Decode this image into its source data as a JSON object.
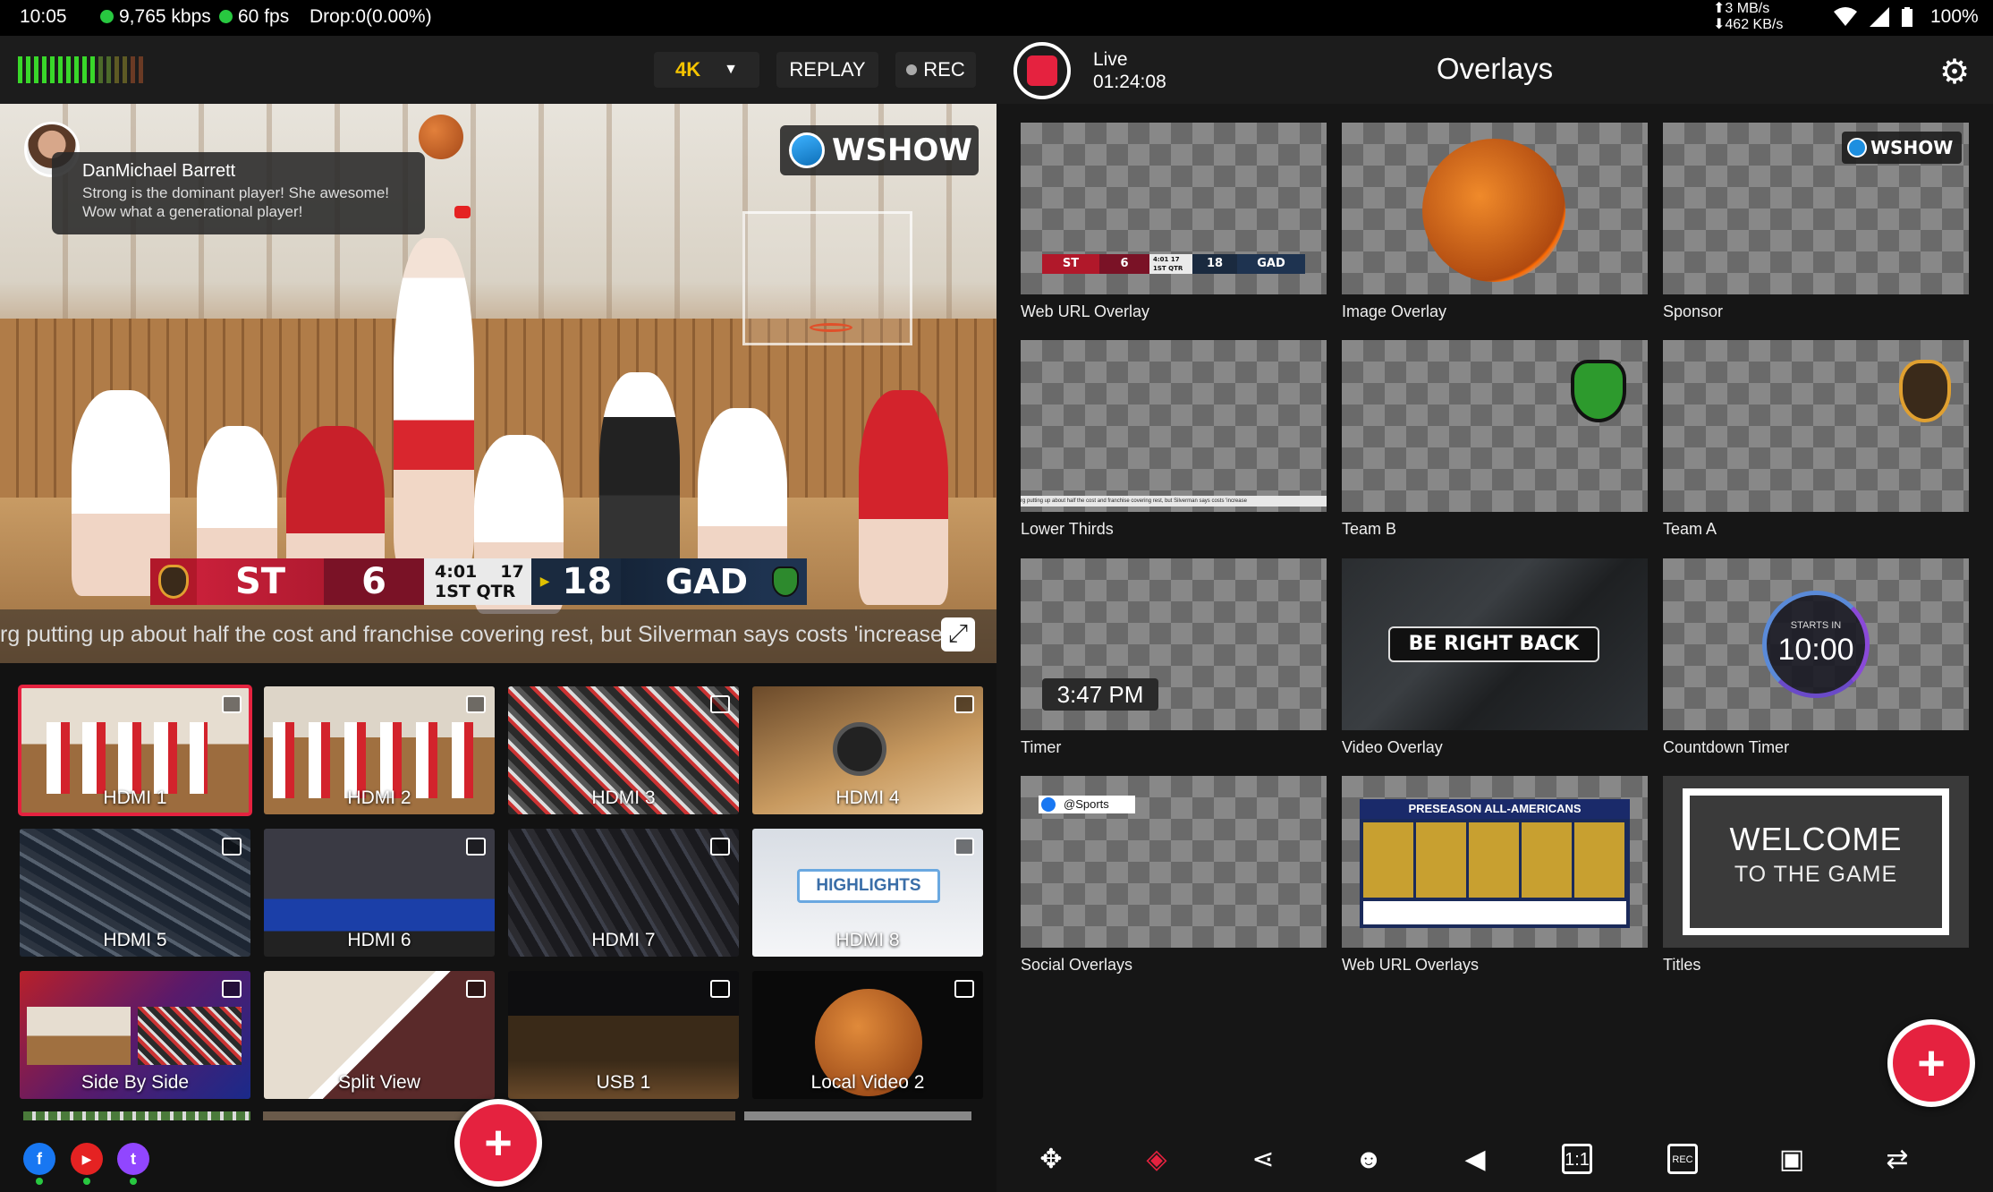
{
  "status": {
    "time": "10:05",
    "bitrate": "9,765 kbps",
    "fps": "60 fps",
    "drop": "Drop:0(0.00%)",
    "upload": "3 MB/s",
    "download": "462 KB/s",
    "battery": "100%"
  },
  "left": {
    "resolution": "4K",
    "replay": "REPLAY",
    "rec": "REC",
    "comment": {
      "name": "DanMichael Barrett",
      "line1": "Strong is the dominant player! She awesome!",
      "line2": "Wow what a generational player!"
    },
    "brand": "WSHOW",
    "score": {
      "home": "ST",
      "home_score": "6",
      "clock": "4:01",
      "shot": "17",
      "period": "1ST QTR",
      "away_score": "18",
      "away": "GAD"
    },
    "ticker": "rg putting up about half the cost and franchise covering rest, but Silverman says costs 'increase",
    "sources": [
      "HDMI 1",
      "HDMI 2",
      "HDMI 3",
      "HDMI 4",
      "HDMI 5",
      "HDMI 6",
      "HDMI 7",
      "HDMI 8",
      "Side By Side",
      "Split View",
      "USB 1",
      "Local Video 2"
    ],
    "highlights_text": "HIGHLIGHTS",
    "social": [
      "f",
      "▶",
      "t"
    ],
    "fab": "+"
  },
  "right": {
    "live": "Live",
    "duration": "01:24:08",
    "title": "Overlays",
    "overlays": [
      "Web URL Overlay",
      "Image Overlay",
      "Sponsor",
      "Lower Thirds",
      "Team B",
      "Team A",
      "Timer",
      "Video Overlay",
      "Countdown Timer",
      "Social Overlays",
      "Web URL Overlays",
      "Titles"
    ],
    "timer_text": "3:47 PM",
    "brb_text": "BE RIGHT BACK",
    "countdown": {
      "label": "STARTS IN",
      "value": "10:00"
    },
    "social_handle": "@Sports",
    "preseason": "PRESEASON ALL-AMERICANS",
    "welcome": {
      "line1": "WELCOME",
      "line2": "TO THE GAME"
    },
    "lower_third_text": "rg putting up about half the cost and franchise covering rest, but Silverman says costs 'increase",
    "mini_score": {
      "home": "ST",
      "home_score": "6",
      "clock": "4:01 17",
      "period": "1ST QTR",
      "away_score": "18",
      "away": "GAD"
    },
    "fab": "+"
  },
  "colors": {
    "accent": "#e5223f",
    "live_green": "#28c840"
  }
}
